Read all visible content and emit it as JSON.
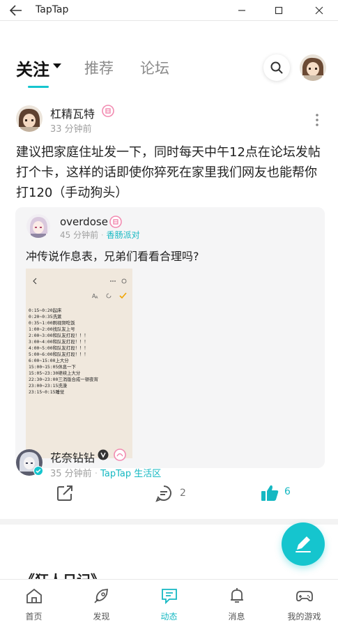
{
  "window": {
    "title": "TapTap"
  },
  "tabs": [
    {
      "label": "关注",
      "active": true
    },
    {
      "label": "推荐",
      "active": false
    },
    {
      "label": "论坛",
      "active": false
    }
  ],
  "colors": {
    "accent": "#15c5ce",
    "muted": "#a0a0a0",
    "quote_bg": "#f5f5f6"
  },
  "post": {
    "author": "杠精瓦特",
    "time": "33 分钟前",
    "text": "建议把家庭住址发一下，同时每天中午12点在论坛发帖打个卡，这样的话即使你猝死在家里我们网友也能帮你打120（手动狗头）",
    "quote": {
      "author": "overdose",
      "time": "45 分钟前",
      "channel": "香肠派对",
      "text": "冲传说作息表，兄弟们看看合理吗?",
      "image_lines": [
        "0:15~0:20起床",
        "0:20~0:35洗漱",
        "0:35~1:00刷视频吃饭",
        "1:00~2:00找队友上号",
        "2:00~3:00和队友打段！！！",
        "3:00~4:00和队友打段！！！",
        "4:00~5:00和队友打段！！！",
        "5:00~6:00和队友打段！！！",
        "6:00~15:00上大分",
        "15:00~15:05休息一下",
        "15:05~23:30继续上大分",
        "22:30~23:00三消版合成一顿夜宵",
        "23:00~23:15洗澡",
        "23:15~0:15睡觉"
      ]
    },
    "comments": "2",
    "likes": "6"
  },
  "post2": {
    "author": "花奈钻钻",
    "time": "35 分钟前",
    "channel": "TapTap 生活区",
    "title": "《狂人日记》"
  },
  "bottom_nav": [
    {
      "label": "首页",
      "icon": "home-icon"
    },
    {
      "label": "发现",
      "icon": "discover-icon"
    },
    {
      "label": "动态",
      "icon": "feed-icon",
      "active": true
    },
    {
      "label": "消息",
      "icon": "bell-icon"
    },
    {
      "label": "我的游戏",
      "icon": "gamepad-icon"
    }
  ]
}
